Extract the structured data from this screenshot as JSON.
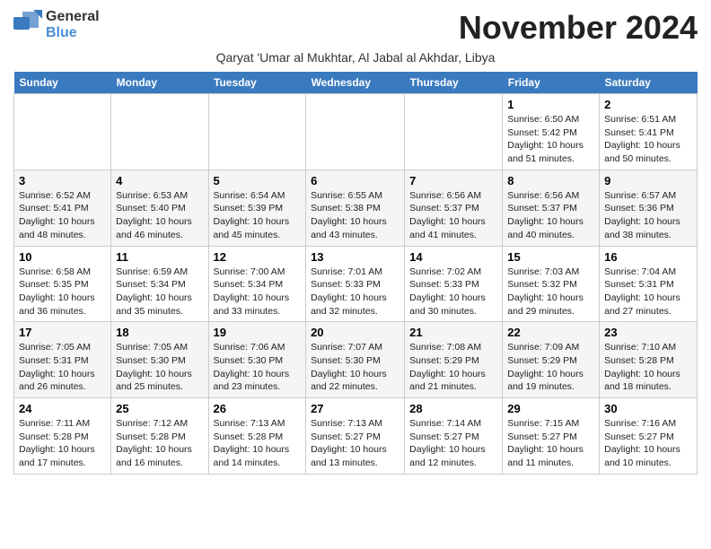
{
  "header": {
    "logo_general": "General",
    "logo_blue": "Blue",
    "month_title": "November 2024",
    "subtitle": "Qaryat 'Umar al Mukhtar, Al Jabal al Akhdar, Libya"
  },
  "days_of_week": [
    "Sunday",
    "Monday",
    "Tuesday",
    "Wednesday",
    "Thursday",
    "Friday",
    "Saturday"
  ],
  "weeks": [
    [
      {
        "day": "",
        "info": ""
      },
      {
        "day": "",
        "info": ""
      },
      {
        "day": "",
        "info": ""
      },
      {
        "day": "",
        "info": ""
      },
      {
        "day": "",
        "info": ""
      },
      {
        "day": "1",
        "info": "Sunrise: 6:50 AM\nSunset: 5:42 PM\nDaylight: 10 hours and 51 minutes."
      },
      {
        "day": "2",
        "info": "Sunrise: 6:51 AM\nSunset: 5:41 PM\nDaylight: 10 hours and 50 minutes."
      }
    ],
    [
      {
        "day": "3",
        "info": "Sunrise: 6:52 AM\nSunset: 5:41 PM\nDaylight: 10 hours and 48 minutes."
      },
      {
        "day": "4",
        "info": "Sunrise: 6:53 AM\nSunset: 5:40 PM\nDaylight: 10 hours and 46 minutes."
      },
      {
        "day": "5",
        "info": "Sunrise: 6:54 AM\nSunset: 5:39 PM\nDaylight: 10 hours and 45 minutes."
      },
      {
        "day": "6",
        "info": "Sunrise: 6:55 AM\nSunset: 5:38 PM\nDaylight: 10 hours and 43 minutes."
      },
      {
        "day": "7",
        "info": "Sunrise: 6:56 AM\nSunset: 5:37 PM\nDaylight: 10 hours and 41 minutes."
      },
      {
        "day": "8",
        "info": "Sunrise: 6:56 AM\nSunset: 5:37 PM\nDaylight: 10 hours and 40 minutes."
      },
      {
        "day": "9",
        "info": "Sunrise: 6:57 AM\nSunset: 5:36 PM\nDaylight: 10 hours and 38 minutes."
      }
    ],
    [
      {
        "day": "10",
        "info": "Sunrise: 6:58 AM\nSunset: 5:35 PM\nDaylight: 10 hours and 36 minutes."
      },
      {
        "day": "11",
        "info": "Sunrise: 6:59 AM\nSunset: 5:34 PM\nDaylight: 10 hours and 35 minutes."
      },
      {
        "day": "12",
        "info": "Sunrise: 7:00 AM\nSunset: 5:34 PM\nDaylight: 10 hours and 33 minutes."
      },
      {
        "day": "13",
        "info": "Sunrise: 7:01 AM\nSunset: 5:33 PM\nDaylight: 10 hours and 32 minutes."
      },
      {
        "day": "14",
        "info": "Sunrise: 7:02 AM\nSunset: 5:33 PM\nDaylight: 10 hours and 30 minutes."
      },
      {
        "day": "15",
        "info": "Sunrise: 7:03 AM\nSunset: 5:32 PM\nDaylight: 10 hours and 29 minutes."
      },
      {
        "day": "16",
        "info": "Sunrise: 7:04 AM\nSunset: 5:31 PM\nDaylight: 10 hours and 27 minutes."
      }
    ],
    [
      {
        "day": "17",
        "info": "Sunrise: 7:05 AM\nSunset: 5:31 PM\nDaylight: 10 hours and 26 minutes."
      },
      {
        "day": "18",
        "info": "Sunrise: 7:05 AM\nSunset: 5:30 PM\nDaylight: 10 hours and 25 minutes."
      },
      {
        "day": "19",
        "info": "Sunrise: 7:06 AM\nSunset: 5:30 PM\nDaylight: 10 hours and 23 minutes."
      },
      {
        "day": "20",
        "info": "Sunrise: 7:07 AM\nSunset: 5:30 PM\nDaylight: 10 hours and 22 minutes."
      },
      {
        "day": "21",
        "info": "Sunrise: 7:08 AM\nSunset: 5:29 PM\nDaylight: 10 hours and 21 minutes."
      },
      {
        "day": "22",
        "info": "Sunrise: 7:09 AM\nSunset: 5:29 PM\nDaylight: 10 hours and 19 minutes."
      },
      {
        "day": "23",
        "info": "Sunrise: 7:10 AM\nSunset: 5:28 PM\nDaylight: 10 hours and 18 minutes."
      }
    ],
    [
      {
        "day": "24",
        "info": "Sunrise: 7:11 AM\nSunset: 5:28 PM\nDaylight: 10 hours and 17 minutes."
      },
      {
        "day": "25",
        "info": "Sunrise: 7:12 AM\nSunset: 5:28 PM\nDaylight: 10 hours and 16 minutes."
      },
      {
        "day": "26",
        "info": "Sunrise: 7:13 AM\nSunset: 5:28 PM\nDaylight: 10 hours and 14 minutes."
      },
      {
        "day": "27",
        "info": "Sunrise: 7:13 AM\nSunset: 5:27 PM\nDaylight: 10 hours and 13 minutes."
      },
      {
        "day": "28",
        "info": "Sunrise: 7:14 AM\nSunset: 5:27 PM\nDaylight: 10 hours and 12 minutes."
      },
      {
        "day": "29",
        "info": "Sunrise: 7:15 AM\nSunset: 5:27 PM\nDaylight: 10 hours and 11 minutes."
      },
      {
        "day": "30",
        "info": "Sunrise: 7:16 AM\nSunset: 5:27 PM\nDaylight: 10 hours and 10 minutes."
      }
    ]
  ]
}
